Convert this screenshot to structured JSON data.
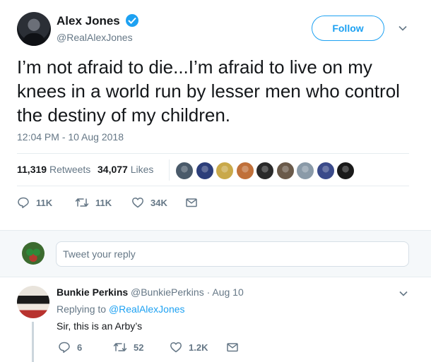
{
  "tweet": {
    "author_name": "Alex Jones",
    "author_handle": "@RealAlexJones",
    "follow_label": "Follow",
    "text": "I’m not afraid to die...I’m afraid to live on my knees in a world run by lesser men who control the destiny of my children.",
    "timestamp": "12:04 PM - 10 Aug 2018",
    "retweets_count": "11,319",
    "retweets_label": "Retweets",
    "likes_count": "34,077",
    "likes_label": "Likes",
    "actions": {
      "reply_count": "11K",
      "retweet_count": "11K",
      "like_count": "34K"
    },
    "liker_avatar_colors": [
      "#4a5a6a",
      "#2c3e7a",
      "#c9a94a",
      "#c0703a",
      "#2a2a2a",
      "#6a5a4a",
      "#8a9aa8",
      "#3a4a8a",
      "#1a1a1a"
    ]
  },
  "reply_composer": {
    "placeholder": "Tweet your reply"
  },
  "reply": {
    "author_name": "Bunkie Perkins",
    "author_meta": "@BunkiePerkins · Aug 10",
    "replying_prefix": "Replying to",
    "replying_to": "@RealAlexJones",
    "text": "Sir, this is an Arby’s",
    "actions": {
      "reply_count": "6",
      "retweet_count": "52",
      "like_count": "1.2K"
    }
  },
  "colors": {
    "accent": "#1da1f2",
    "secondary_text": "#657786",
    "primary_text": "#14171a"
  }
}
